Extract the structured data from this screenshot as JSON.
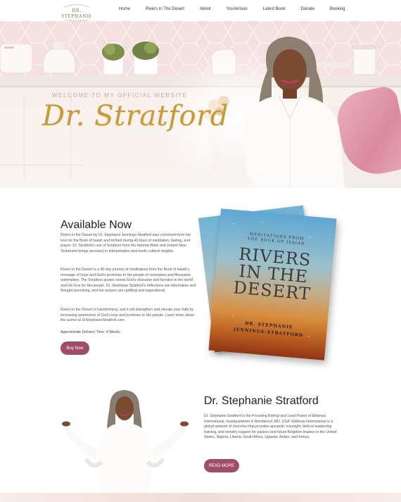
{
  "logo": {
    "line1": "DR. STEPHANIE",
    "line2": "STRATFORD"
  },
  "nav": {
    "items": [
      "Home",
      "Rivers In The Desert",
      "About",
      "YouVersion",
      "Latest Book",
      "Donate",
      "Booking"
    ]
  },
  "hero": {
    "welcome": "WELCOME TO MY OFFICIAL WEBSITE",
    "signature": "Dr. Stratford"
  },
  "available": {
    "title": "Available Now",
    "p1": "Rivers in the Desert by Dr. Stephanie Jennings-Stratford was conceived from her love for the Book of Isaiah and birthed during 40-days of meditation, fasting, and prayer. Dr. Stratford's use of Scripture from the Hebrew Bible and Jewish New Testament brings accuracy in interpretation and lends cultural insights.",
    "p2": "Rivers in the Desert is a 40-day journey of meditations from the Book of Isaiah's message of hope and God's promises to His people of restoration and Messianic redemption. The Scripture quotes reveal God's character and function in the world and His love for His people. Dr. Stephanie Stratford's reflections are informative and thought-provoking, and her prayers are uplifting and inspirational.",
    "p3": "Rivers in the Desert is transforming, and it will strengthen and elevate your faith by increasing awareness of God's love and promises to His people. Learn more about the author at DrStephanieStratford.com.",
    "delivery": "Approximate Delivery Time: 4 Weeks",
    "button": "Buy Now"
  },
  "book": {
    "subtitle_line1": "MEDITATIONS FROM",
    "subtitle_line2": "THE BOOK OF ISAIAH",
    "title_line1": "RIVERS",
    "title_line2": "IN THE",
    "title_line3": "DESERT",
    "author_line1": "DR. STEPHANIE",
    "author_line2": "JENNINGS-STRATFORD"
  },
  "about": {
    "title": "Dr. Stephanie Stratford",
    "text": "Dr. Stephanie Stratford is the Presiding Bishop and Lead Pastor of Ekklesia International, headquartered in Brentwood, MD, USA. Ekklesia International is a global network of churches that provides apostolic oversight, biblical leadership training, and ministry support for pastors and future Kingdom leaders in the United States, Nigeria, Liberia, South Africa, Uganda, Belize, and Kenya.",
    "button": "READ MORE"
  },
  "colors": {
    "accent": "#a04e66",
    "gold": "#c89a3c",
    "pink": "#f4dcdd"
  }
}
